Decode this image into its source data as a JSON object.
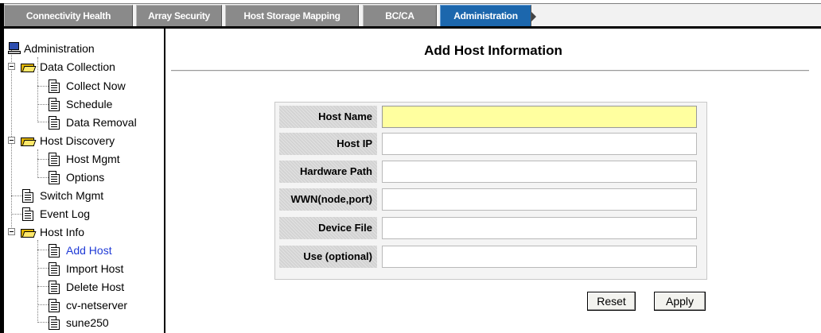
{
  "tabs": [
    {
      "label": "Connectivity Health",
      "active": false
    },
    {
      "label": "Array Security",
      "active": false
    },
    {
      "label": "Host Storage Mapping",
      "active": false
    },
    {
      "label": "BC/CA",
      "active": false
    },
    {
      "label": "Administration",
      "active": true
    }
  ],
  "nav": {
    "root": "Administration",
    "data_collection": "Data Collection",
    "collect_now": "Collect Now",
    "schedule": "Schedule",
    "data_removal": "Data Removal",
    "host_discovery": "Host Discovery",
    "host_mgmt": "Host Mgmt",
    "options": "Options",
    "switch_mgmt": "Switch Mgmt",
    "event_log": "Event Log",
    "host_info": "Host Info",
    "add_host": "Add Host",
    "import_host": "Import Host",
    "delete_host": "Delete Host",
    "cv_netserver": "cv-netserver",
    "sune250": "sune250"
  },
  "main": {
    "title": "Add Host Information",
    "fields": [
      {
        "label": "Host Name",
        "value": ""
      },
      {
        "label": "Host IP",
        "value": ""
      },
      {
        "label": "Hardware Path",
        "value": ""
      },
      {
        "label": "WWN(node,port)",
        "value": ""
      },
      {
        "label": "Device File",
        "value": ""
      },
      {
        "label": "Use (optional)",
        "value": ""
      }
    ],
    "reset_label": "Reset",
    "apply_label": "Apply"
  },
  "colors": {
    "active_tab": "#1c67ad",
    "inactive_tab": "#8a8a8a",
    "link": "#1f3ad6",
    "focused_input": "#ffff9f"
  },
  "icons": {
    "root": "computer-icon",
    "folder": "open-folder-icon",
    "page": "document-icon",
    "expander": "collapse-minus-icon"
  }
}
